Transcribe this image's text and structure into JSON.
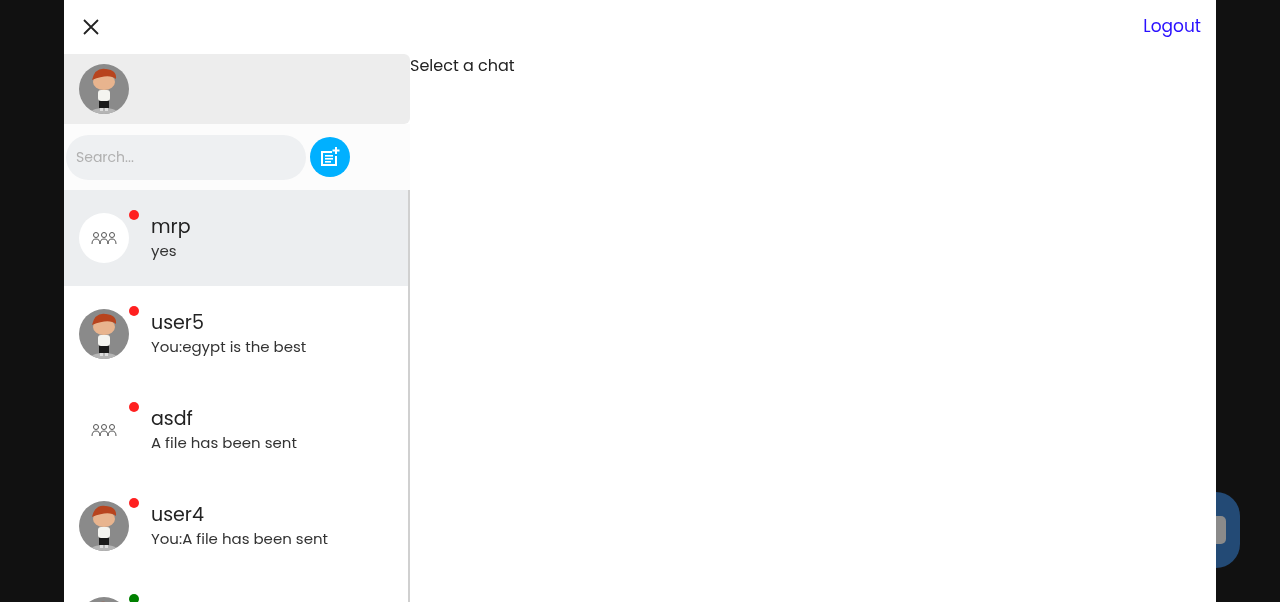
{
  "header": {
    "logout": "Logout"
  },
  "profile": {
    "kind": "picture"
  },
  "search": {
    "placeholder": "Search..."
  },
  "chats": [
    {
      "name": "mrp",
      "preview": "yes",
      "kind": "group",
      "color": "#ff2020",
      "selected": true
    },
    {
      "name": "user5",
      "preview": "You:egypt is the best",
      "kind": "picture",
      "color": "#ff2020",
      "selected": false
    },
    {
      "name": "asdf",
      "preview": "A file has been sent",
      "kind": "group-plain",
      "color": "#ff2020",
      "selected": false
    },
    {
      "name": "user4",
      "preview": "You:A file has been sent",
      "kind": "picture",
      "color": "#ff2020",
      "selected": false
    },
    {
      "kind": "picture",
      "color": "#008000",
      "selected": false
    }
  ],
  "main": {
    "placeholder_text": "Select a chat"
  }
}
